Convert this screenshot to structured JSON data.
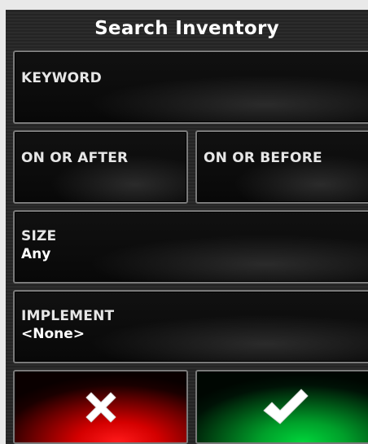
{
  "dialog": {
    "title": "Search Inventory"
  },
  "fields": {
    "keyword": {
      "label": "KEYWORD",
      "value": ""
    },
    "on_or_after": {
      "label": "ON OR AFTER",
      "value": ""
    },
    "on_or_before": {
      "label": "ON OR BEFORE",
      "value": ""
    },
    "size": {
      "label": "SIZE",
      "value": "Any"
    },
    "implement": {
      "label": "IMPLEMENT",
      "value": "<None>"
    }
  },
  "buttons": {
    "cancel": {
      "icon": "close-icon",
      "color": "#e00000"
    },
    "confirm": {
      "icon": "checkmark-icon",
      "color": "#00b030"
    }
  }
}
